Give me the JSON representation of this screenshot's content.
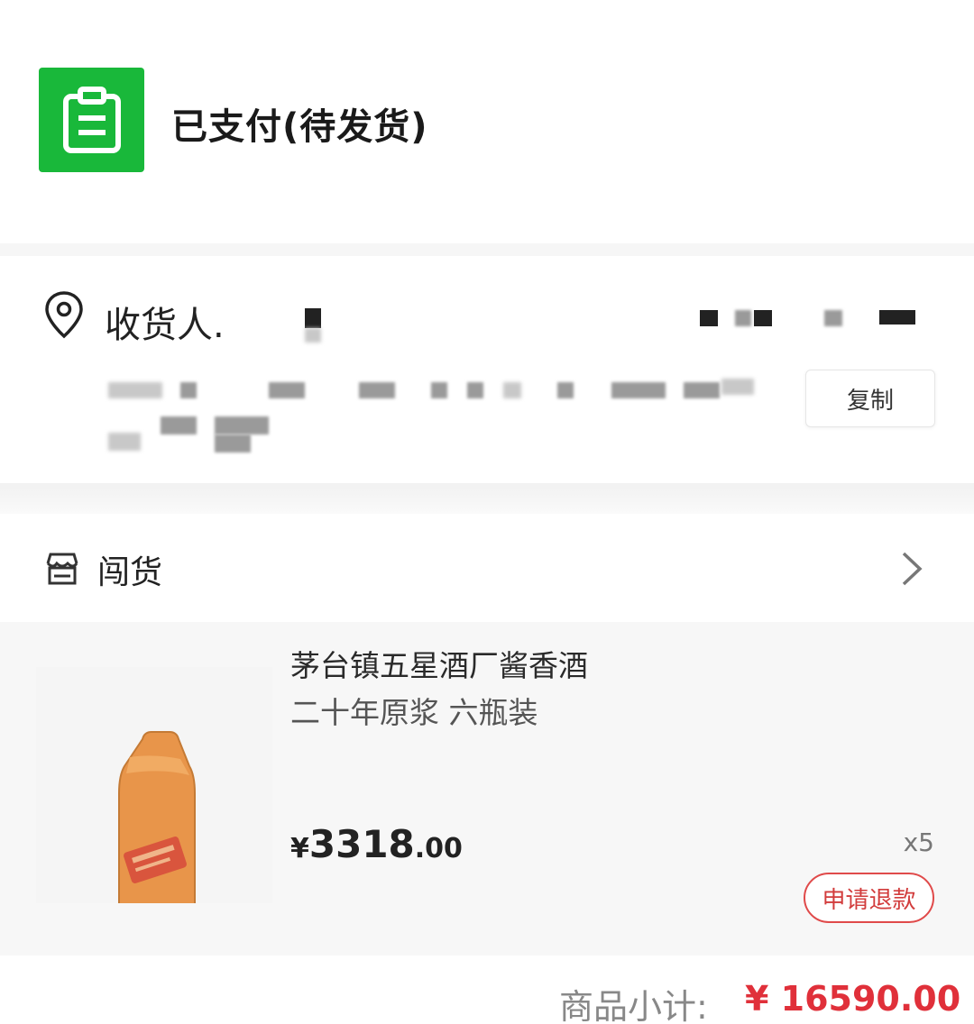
{
  "status": {
    "title": "已支付(待发货)",
    "icon": "clipboard-icon",
    "color": "#19b83a"
  },
  "address": {
    "receiver_label": "收货人.",
    "copy_label": "复制",
    "icon": "location-pin-icon"
  },
  "shop": {
    "name": "闯货",
    "icon": "store-icon"
  },
  "product": {
    "title": "茅台镇五星酒厂酱香酒",
    "spec": "二十年原浆 六瓶装",
    "price_symbol": "¥",
    "price_int": "3318",
    "price_dec": ".00",
    "quantity": "x5",
    "refund_label": "申请退款"
  },
  "subtotal": {
    "label": "商品小计:",
    "value": "¥ 16590.00",
    "color": "#e0303a"
  }
}
